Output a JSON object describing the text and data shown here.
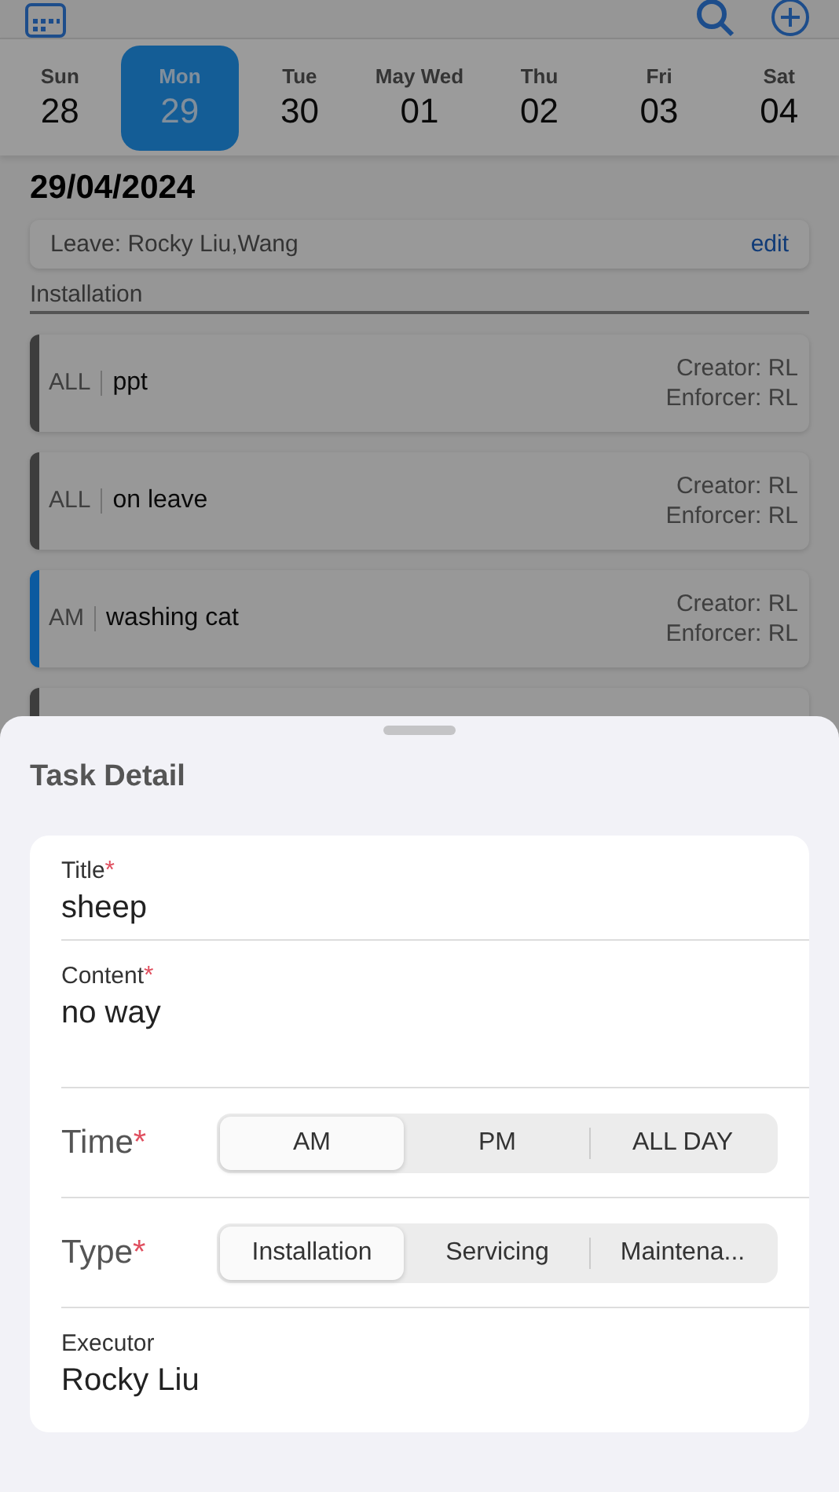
{
  "week": [
    {
      "weekday": "Sun",
      "day": "28",
      "selected": false
    },
    {
      "weekday": "Mon",
      "day": "29",
      "selected": true
    },
    {
      "weekday": "Tue",
      "day": "30",
      "selected": false
    },
    {
      "weekday": "May Wed",
      "day": "01",
      "selected": false
    },
    {
      "weekday": "Thu",
      "day": "02",
      "selected": false
    },
    {
      "weekday": "Fri",
      "day": "03",
      "selected": false
    },
    {
      "weekday": "Sat",
      "day": "04",
      "selected": false
    }
  ],
  "date_title": "29/04/2024",
  "leave": {
    "text": "Leave: Rocky Liu,Wang",
    "action": "edit"
  },
  "section": "Installation",
  "tasks": [
    {
      "period": "ALL",
      "title": "ppt",
      "creator": "Creator: RL",
      "enforcer": "Enforcer: RL",
      "color": "#3d3d3d"
    },
    {
      "period": "ALL",
      "title": "on leave",
      "creator": "Creator: RL",
      "enforcer": "Enforcer: RL",
      "color": "#3d3d3d"
    },
    {
      "period": "AM",
      "title": "washing cat",
      "creator": "Creator: RL",
      "enforcer": "Enforcer: RL",
      "color": "#0b5aa0"
    },
    {
      "color": "#3d3d3d"
    }
  ],
  "sheet": {
    "title": "Task Detail",
    "fields": [
      {
        "kind": "text",
        "label": "Title",
        "required_mark": "*",
        "value": "sheep"
      },
      {
        "kind": "textarea",
        "label": "Content",
        "required_mark": "*",
        "value": "no way"
      },
      {
        "kind": "segmented",
        "label": "Time",
        "required_mark": "*",
        "options": [
          {
            "label": "AM",
            "selected": true
          },
          {
            "label": "PM",
            "selected": false
          },
          {
            "label": "ALL DAY",
            "selected": false
          }
        ]
      },
      {
        "kind": "segmented",
        "label": "Type",
        "required_mark": "*",
        "options": [
          {
            "label": "Installation",
            "selected": true
          },
          {
            "label": "Servicing",
            "selected": false
          },
          {
            "label": "Maintena...",
            "selected": false
          }
        ]
      },
      {
        "kind": "text",
        "label": "Executor",
        "value": "Rocky Liu"
      }
    ]
  }
}
